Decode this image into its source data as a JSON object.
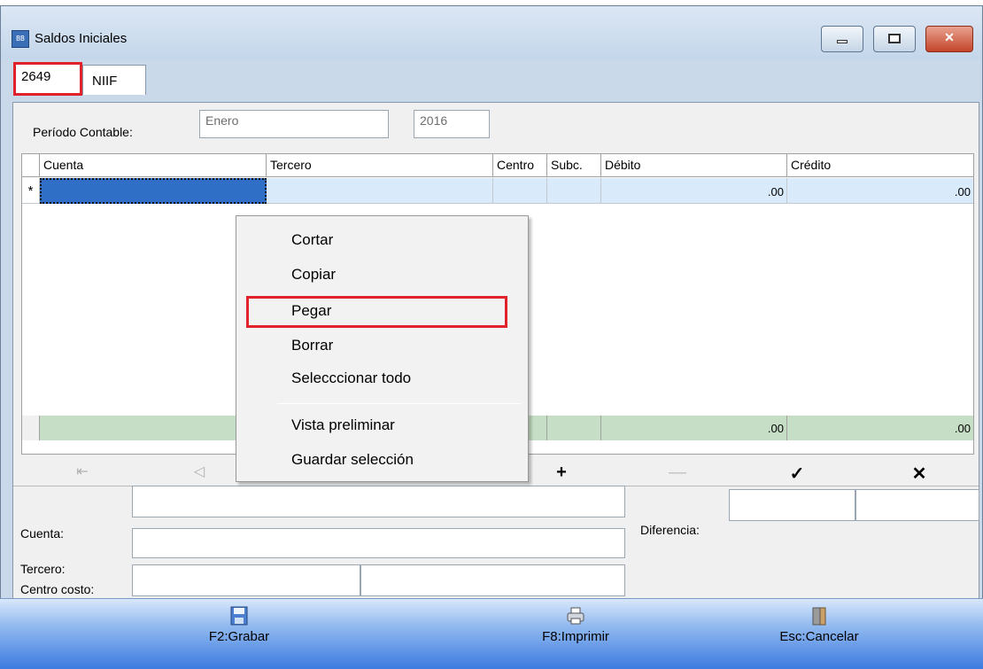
{
  "window": {
    "title": "Saldos Iniciales",
    "app_icon_text": "BB"
  },
  "tabs": [
    {
      "label": "2649",
      "highlighted": true
    },
    {
      "label": "NIIF"
    }
  ],
  "period": {
    "label": "Período Contable:",
    "month": "Enero",
    "year": "2016"
  },
  "grid": {
    "columns": [
      "Cuenta",
      "Tercero",
      "Centro",
      "Subc.",
      "Débito",
      "Crédito"
    ],
    "new_row_marker": "*",
    "new_row": {
      "debito": ".00",
      "credito": ".00"
    },
    "totals": {
      "debito": ".00",
      "credito": ".00"
    }
  },
  "nav": {
    "first": "⇤",
    "prev": "◁",
    "add": "+",
    "remove": "—",
    "confirm": "✓",
    "cancel": "✕"
  },
  "context_menu": {
    "items": [
      "Cortar",
      "Copiar",
      "Pegar",
      "Borrar",
      "Selecccionar todo",
      "Vista preliminar",
      "Guardar selección"
    ],
    "highlighted_item": "Pegar"
  },
  "details": {
    "cuenta_label": "Cuenta:",
    "tercero_label": "Tercero:",
    "centro_costo_label": "Centro costo:",
    "diferencia_label": "Diferencia:"
  },
  "footer": {
    "save": "F2:Grabar",
    "print": "F8:Imprimir",
    "cancel": "Esc:Cancelar"
  },
  "colors": {
    "highlight_red": "#e2222b",
    "selected_row": "#d9ebfa",
    "totals_row": "#c6dec6",
    "footer_blue": "#3d7be0"
  },
  "icons": [
    "app-icon",
    "minimize-icon",
    "maximize-icon",
    "close-icon",
    "save-icon",
    "print-icon",
    "exit-door-icon"
  ]
}
